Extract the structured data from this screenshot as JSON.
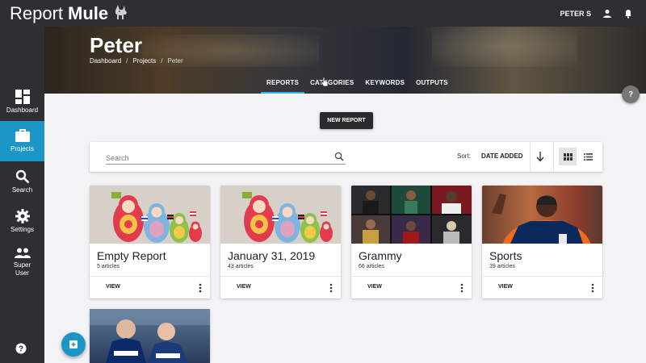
{
  "app": {
    "brand_part1": "Report",
    "brand_part2": "Mule",
    "user_name": "PETER S"
  },
  "sidebar": {
    "items": [
      {
        "label": "Dashboard",
        "icon": "dashboard-icon",
        "active": false
      },
      {
        "label": "Projects",
        "icon": "briefcase-icon",
        "active": true
      },
      {
        "label": "Search",
        "icon": "search-icon",
        "active": false
      },
      {
        "label": "Settings",
        "icon": "gear-icon",
        "active": false
      },
      {
        "label": "Super",
        "label2": "User",
        "icon": "people-icon",
        "active": false
      }
    ],
    "help_icon": "help-icon"
  },
  "hero": {
    "title": "Peter",
    "breadcrumb": [
      "Dashboard",
      "Projects",
      "Peter"
    ],
    "tabs": [
      "REPORTS",
      "CATEGORIES",
      "KEYWORDS",
      "OUTPUTS"
    ],
    "active_tab": "REPORTS"
  },
  "help_button": "?",
  "toolbar": {
    "new_report_label": "NEW REPORT"
  },
  "search": {
    "placeholder": "Search",
    "value": "",
    "sort_label": "Sort:",
    "sort_value": "DATE ADDED",
    "sort_direction": "descending",
    "view_mode": "grid"
  },
  "reports": [
    {
      "title": "Empty Report",
      "count": "5 articles",
      "image": "nesting-dolls",
      "action": "VIEW"
    },
    {
      "title": "January 31, 2019",
      "count": "43 articles",
      "image": "nesting-dolls",
      "action": "VIEW"
    },
    {
      "title": "Grammy",
      "count": "66 articles",
      "image": "photo-collage",
      "action": "VIEW"
    },
    {
      "title": "Sports",
      "count": "39 articles",
      "image": "football-player",
      "action": "VIEW"
    },
    {
      "title": "",
      "count": "",
      "image": "hockey-players",
      "action": ""
    }
  ],
  "colors": {
    "accent": "#1e95c7",
    "topbar": "#2f2f33",
    "tab_underline": "#2fb4e8"
  }
}
